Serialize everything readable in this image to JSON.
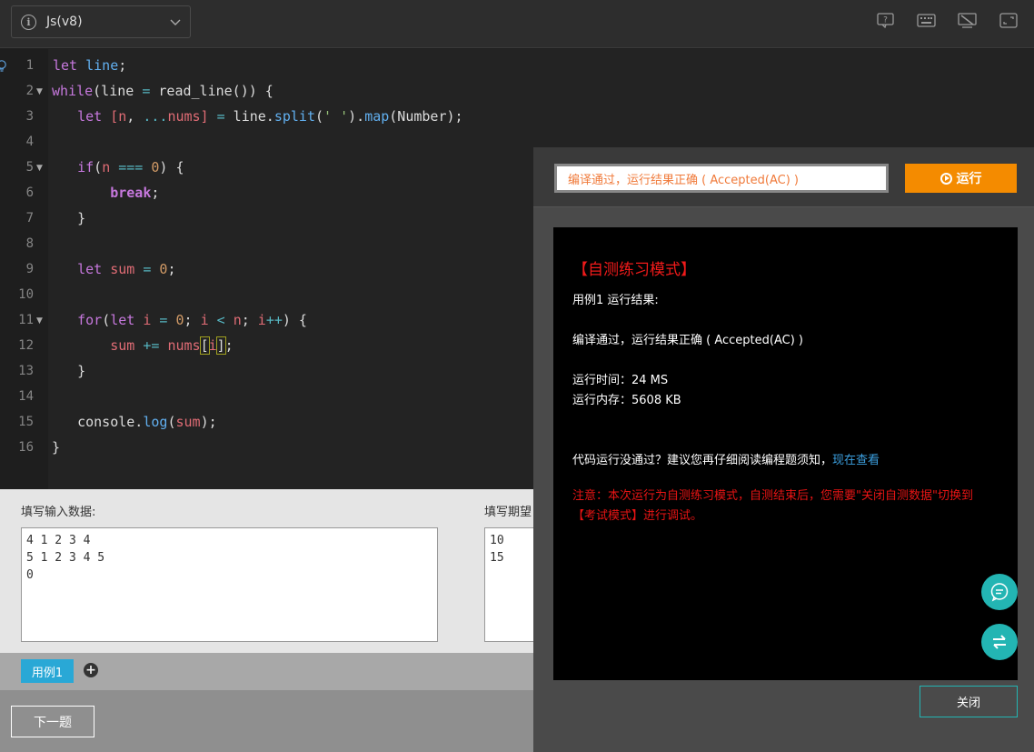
{
  "toolbar": {
    "language": "Js(v8)",
    "icons": [
      "help-icon",
      "keyboard-icon",
      "settings-icon",
      "fullscreen-icon"
    ]
  },
  "editor": {
    "line_numbers": [
      "1",
      "2",
      "3",
      "4",
      "5",
      "6",
      "7",
      "8",
      "9",
      "10",
      "11",
      "12",
      "13",
      "14",
      "15",
      "16"
    ]
  },
  "io": {
    "input_label": "填写输入数据:",
    "input_value": "4 1 2 3 4\n5 1 2 3 4 5\n0",
    "expected_label": "填写期望",
    "expected_value": "10\n15"
  },
  "cases": {
    "tab_label": "用例1",
    "add_symbol": "+"
  },
  "footer": {
    "next_label": "下一题"
  },
  "result": {
    "status_text": "编译通过，运行结果正确 ( Accepted(AC) )",
    "run_label": "运行",
    "mode_title": "【自测练习模式】",
    "case_result_title": "用例1 运行结果:",
    "compile_status": "编译通过，运行结果正确 ( Accepted(AC) )",
    "run_time": "运行时间：24 MS",
    "run_memory": "运行内存：5608 KB",
    "hint_text": "代码运行没通过？建议您再仔细阅读编程题须知，",
    "hint_link": "现在查看",
    "notice_line1": "注意：本次运行为自测练习模式，自测结束后，您需要\"关闭自测数据\"切换到",
    "notice_line2": "【考试模式】进行调试。",
    "close_label": "关闭"
  },
  "colors": {
    "accent_orange": "#f48b00",
    "teal": "#23b5b3",
    "case_tab_blue": "#29a8d6",
    "error_red": "#e81414"
  }
}
